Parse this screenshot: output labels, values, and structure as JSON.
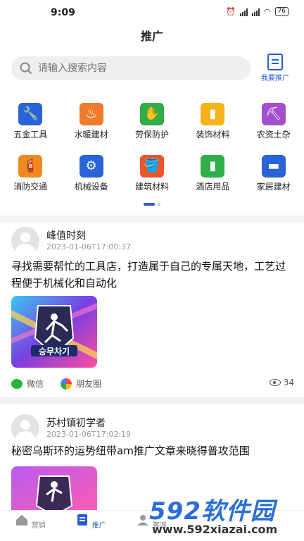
{
  "status": {
    "time": "9:09",
    "battery": "76",
    "net1": "HD",
    "net2": "HD"
  },
  "header": {
    "title": "推广"
  },
  "search": {
    "placeholder": "请输入搜索内容",
    "my_promo_label": "我要推广"
  },
  "categories": [
    {
      "label": "五金工具",
      "icon": "tools-icon",
      "color": "#2a63d6"
    },
    {
      "label": "水暖建材",
      "icon": "radiator-icon",
      "color": "#f07a2e"
    },
    {
      "label": "劳保防护",
      "icon": "gloves-icon",
      "color": "#2fae4a"
    },
    {
      "label": "装饰材料",
      "icon": "paint-roller-icon",
      "color": "#f5b21b"
    },
    {
      "label": "农资土杂",
      "icon": "shovel-icon",
      "color": "#a34fd0"
    },
    {
      "label": "消防交通",
      "icon": "fire-extinguisher-icon",
      "color": "#f08a1e"
    },
    {
      "label": "机械设备",
      "icon": "drill-icon",
      "color": "#2a63d6"
    },
    {
      "label": "建筑材料",
      "icon": "paint-bucket-icon",
      "color": "#e8572b"
    },
    {
      "label": "酒店用品",
      "icon": "bottles-icon",
      "color": "#2fae4a"
    },
    {
      "label": "家居建材",
      "icon": "sofa-icon",
      "color": "#2a63d6"
    }
  ],
  "posts": [
    {
      "author": "峰值时刻",
      "date": "2023-01-06T17:00:37",
      "text": "寻找需要帮忙的工具店，打造属于自己的专属天地，工艺过程便于机械化和自动化",
      "share_wechat": "微信",
      "share_moments": "朋友圈",
      "views": "34",
      "badge_text": "승무차기"
    },
    {
      "author": "苏村镇初学者",
      "date": "2023-01-06T17:02:19",
      "text": "秘密乌斯环的运势纽带am推广文章来晓得普攻范围"
    }
  ],
  "tabbar": [
    {
      "label": "营销",
      "icon": "home-icon",
      "active": false
    },
    {
      "label": "推广",
      "icon": "document-icon",
      "active": true
    },
    {
      "label": "客源",
      "icon": "user-icon",
      "active": false
    }
  ],
  "watermark": {
    "brand": "592软件园",
    "url": "www.592xiazai.com"
  },
  "colors": {
    "accent": "#2a5bd7"
  }
}
